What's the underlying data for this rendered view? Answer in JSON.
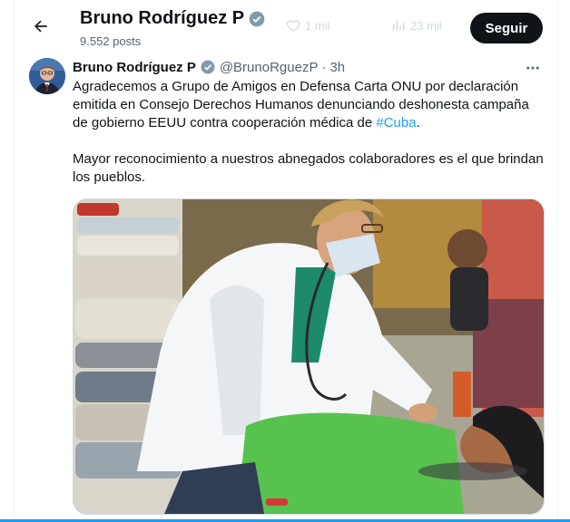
{
  "header": {
    "name": "Bruno Rodríguez P",
    "posts": "9.552 posts",
    "likes_count": "1 mil",
    "views_count": "23 mil",
    "follow_label": "Seguir"
  },
  "tweet": {
    "author_name": "Bruno Rodríguez P",
    "handle": "@BrunoRguezP",
    "separator": "·",
    "time": "3h",
    "text_p1": "Agradecemos a Grupo de Amigos en Defensa Carta ONU por declaración emitida en Consejo Derechos Humanos denunciando deshonesta campaña de gobierno EEUU contra cooperación médica de ",
    "hashtag": "#Cuba",
    "text_p1_end": ".",
    "text_p2": "Mayor reconocimiento a nuestros abnegados colaboradores es el que brindan los pueblos."
  },
  "colors": {
    "accent": "#1d9bf0",
    "verified": "#829aab",
    "text": "#0f1419",
    "muted": "#536471"
  },
  "icons": [
    "back-arrow-icon",
    "verified-badge-icon",
    "heart-icon",
    "views-chart-icon",
    "more-icon"
  ]
}
